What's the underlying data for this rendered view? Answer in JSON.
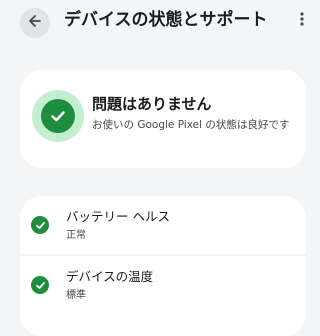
{
  "app_bar": {
    "title": "デバイスの状態とサポート",
    "back_icon": "arrow-back-icon",
    "more_icon": "more-vert-icon"
  },
  "status_card": {
    "icon": "check-icon",
    "title": "問題はありません",
    "description": "お使いの Google Pixel の状態は良好です"
  },
  "items": [
    {
      "icon": "check-circle-icon",
      "title": "バッテリー ヘルス",
      "subtitle": "正常"
    },
    {
      "icon": "check-circle-icon",
      "title": "デバイスの温度",
      "subtitle": "標準"
    }
  ],
  "colors": {
    "background": "#f4f5f6",
    "card": "#ffffff",
    "accent_green": "#1e8e3e",
    "status_halo": "#c4eed0",
    "text_primary": "#1b1c1e",
    "text_secondary": "#43474e"
  }
}
